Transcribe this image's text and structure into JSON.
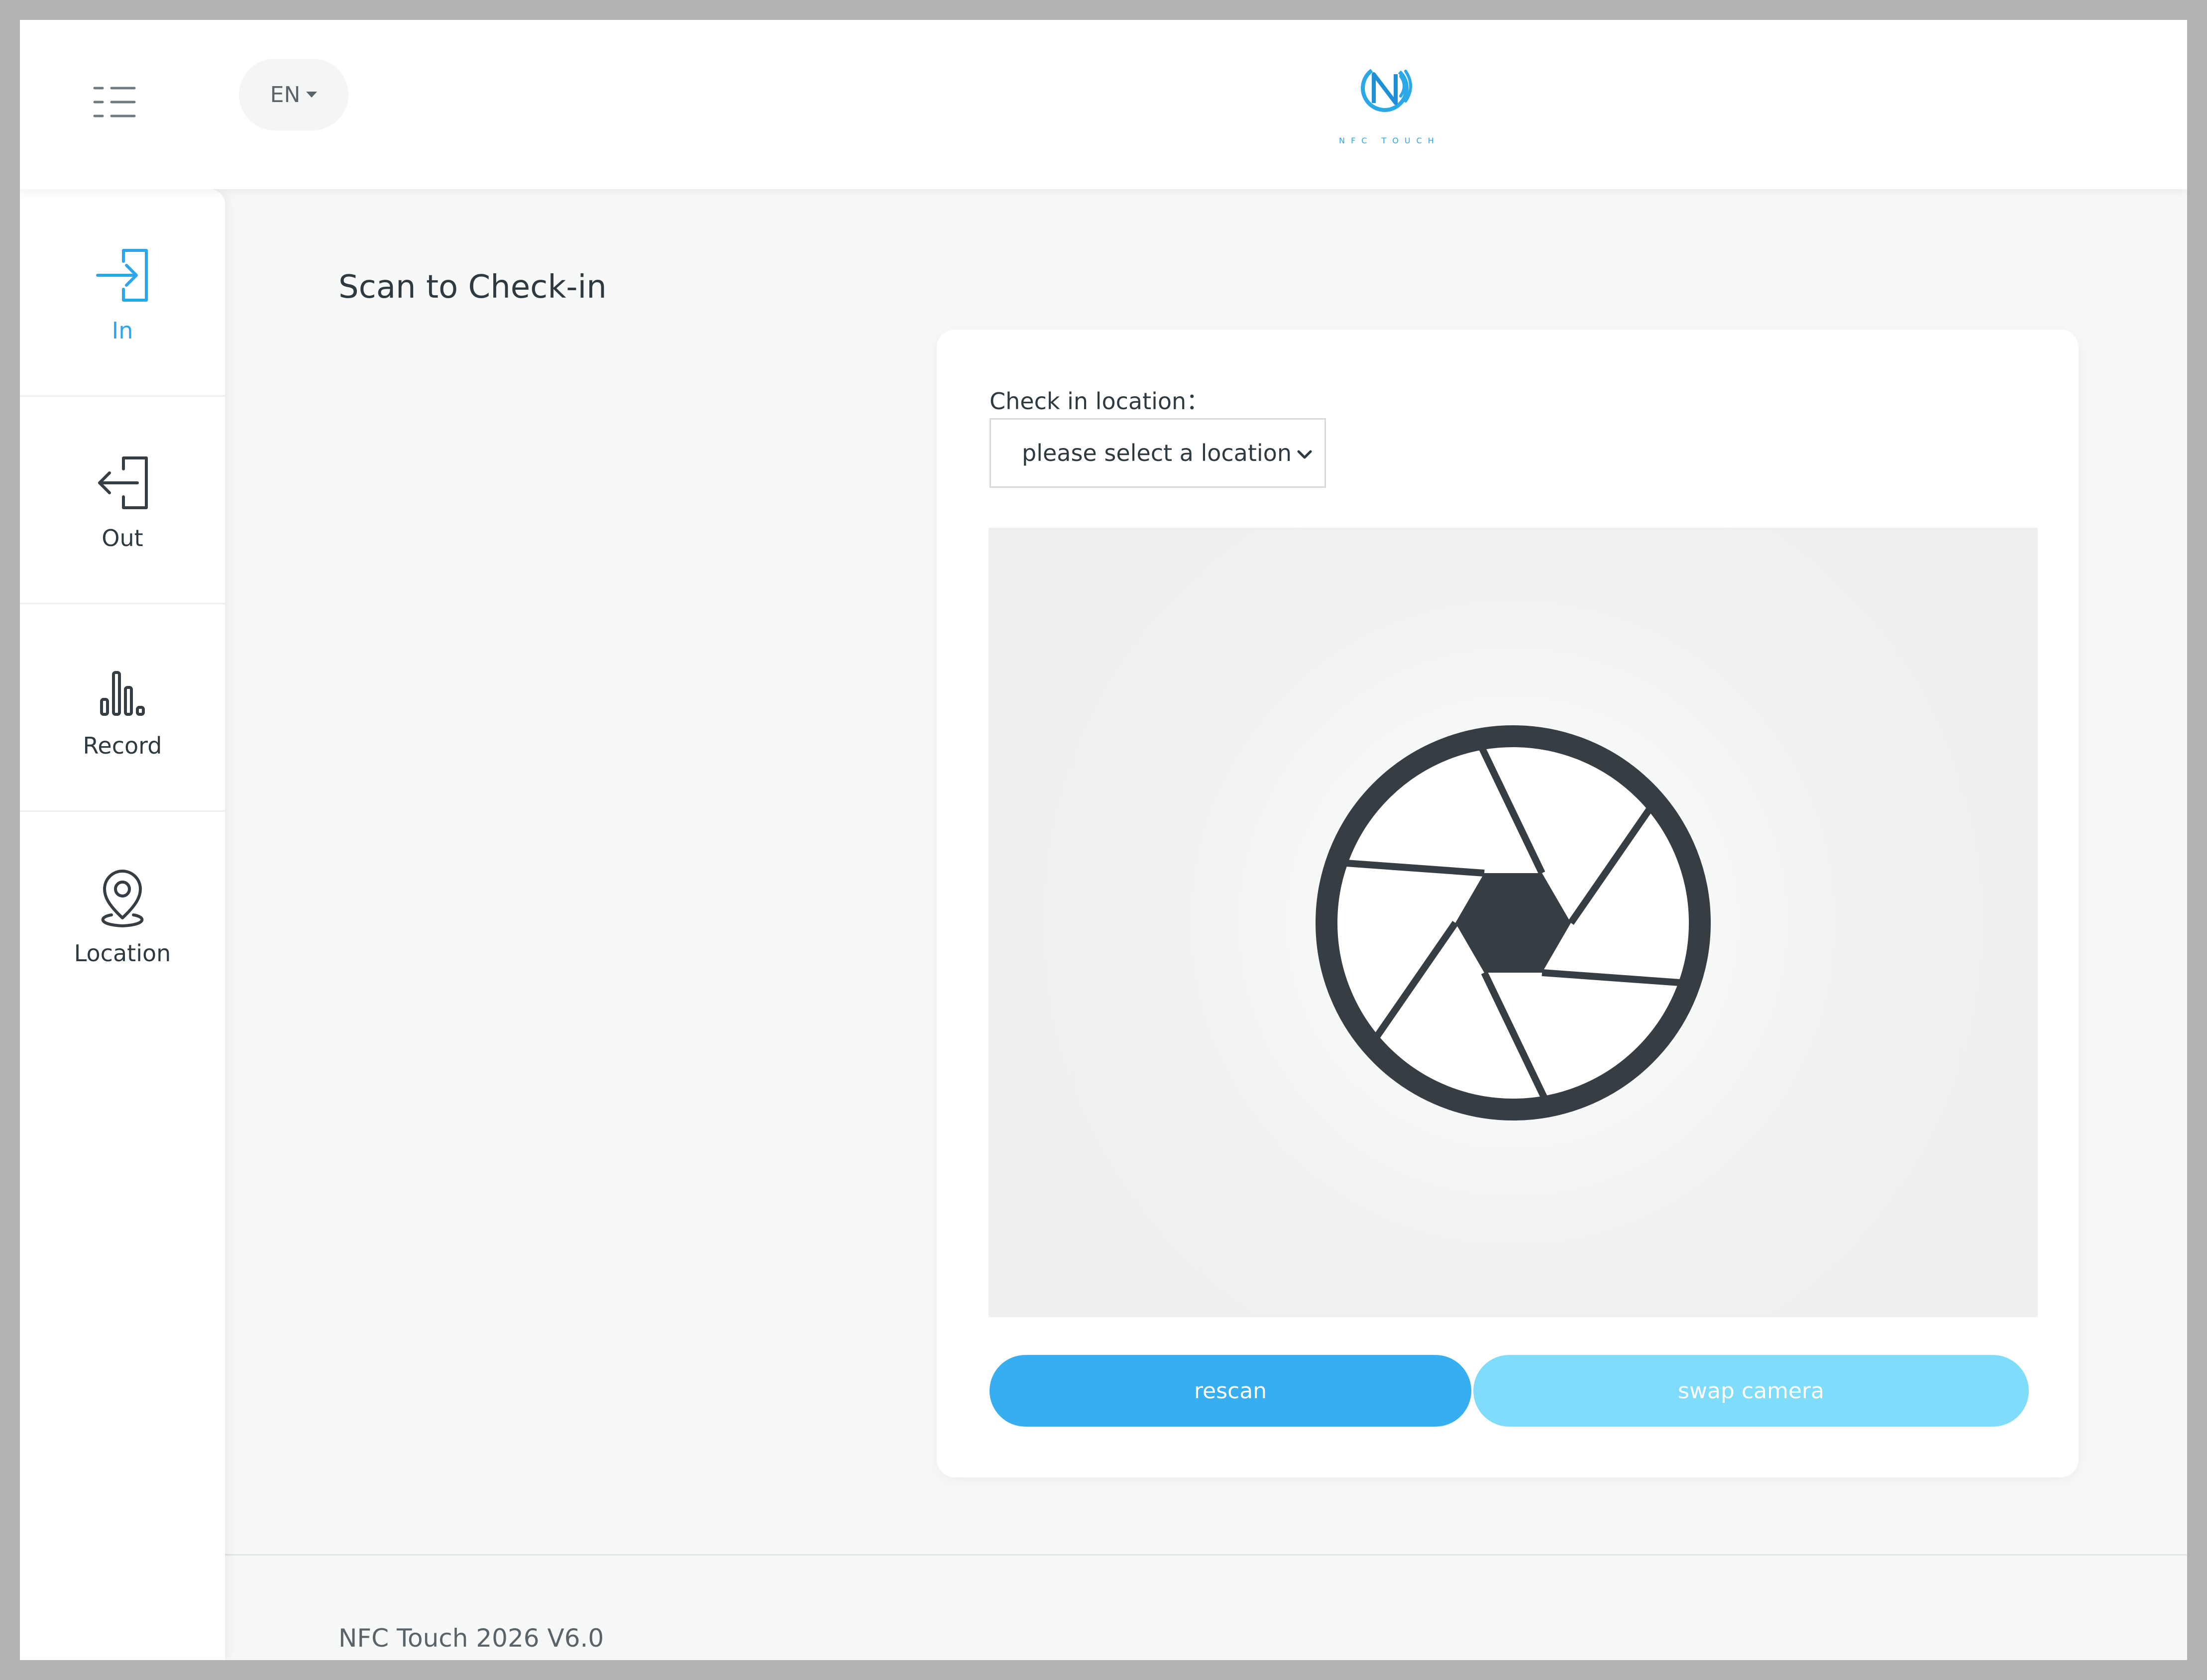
{
  "header": {
    "menu_icon": "list-menu-icon",
    "language": "EN",
    "logo_text": "NFC TOUCH"
  },
  "sidebar": {
    "items": [
      {
        "label": "In",
        "icon": "sign-in-icon",
        "active": true
      },
      {
        "label": "Out",
        "icon": "sign-out-icon",
        "active": false
      },
      {
        "label": "Record",
        "icon": "bar-chart-icon",
        "active": false
      },
      {
        "label": "Location",
        "icon": "location-pin-icon",
        "active": false
      }
    ]
  },
  "main": {
    "title": "Scan to Check-in",
    "location_label": "Check in location：",
    "location_select_value": "please select a location",
    "scanner_icon": "camera-aperture-icon",
    "rescan_label": "rescan",
    "swap_camera_label": "swap camera"
  },
  "footer": {
    "text": "NFC Touch 2026 V6.0"
  },
  "colors": {
    "accent": "#2ba6ea",
    "rescan_button": "#37aef0",
    "swap_button": "#7fdcfa",
    "icon_dark": "#363e44"
  }
}
